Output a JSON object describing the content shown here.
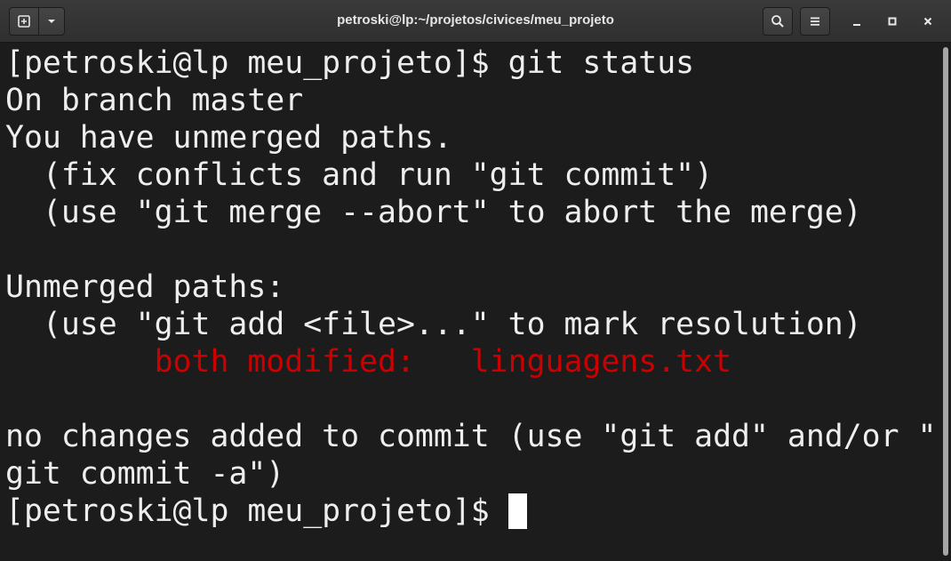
{
  "window": {
    "title": "petroski@lp:~/projetos/civices/meu_projeto"
  },
  "header": {
    "icons": [
      "new-tab-icon",
      "chevron-down-icon",
      "search-icon",
      "hamburger-menu-icon",
      "minimize-icon",
      "maximize-icon",
      "close-icon"
    ]
  },
  "terminal": {
    "lines": [
      "[petroski@lp meu_projeto]$ git status",
      "On branch master",
      "You have unmerged paths.",
      "  (fix conflicts and run \"git commit\")",
      "  (use \"git merge --abort\" to abort the merge)",
      "",
      "Unmerged paths:",
      "  (use \"git add <file>...\" to mark resolution)",
      "        both modified:   linguagens.txt",
      "",
      "no changes added to commit (use \"git add\" and/or \"",
      "git commit -a\")",
      "[petroski@lp meu_projeto]$ "
    ],
    "highlight_color": "#cc0000",
    "text_color": "#eeeeee",
    "background_color": "#1c1c1c"
  }
}
